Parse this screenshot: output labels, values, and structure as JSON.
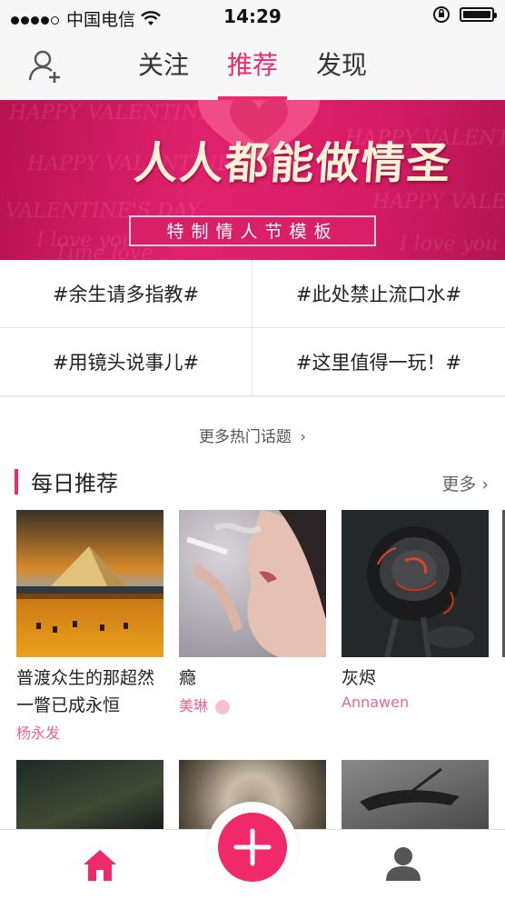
{
  "status_bar": {
    "carrier": "中国电信",
    "time": "14:29"
  },
  "header": {
    "tabs": [
      {
        "label": "关注"
      },
      {
        "label": "推荐"
      },
      {
        "label": "发现"
      }
    ]
  },
  "banner": {
    "title": "人人都能做情圣",
    "subtitle": "特制情人节模板",
    "bg_text": [
      "HAPPY VALENTINE'S DAY",
      "I love you",
      "HAPPY VALENTINE",
      "VALENTINE'S DAY",
      "Time love"
    ]
  },
  "topics": [
    "#余生请多指教#",
    "#此处禁止流口水#",
    "#用镜头说事儿#",
    "#这里值得一玩！#"
  ],
  "more_topics": "更多热门话题",
  "daily": {
    "title": "每日推荐",
    "more": "更多",
    "cards": [
      {
        "title": "普渡众生的那超然一瞥已成永恒",
        "author": "杨永发"
      },
      {
        "title": "瘾",
        "author": "美琳"
      },
      {
        "title": "灰烬",
        "author": "Annawen"
      }
    ]
  },
  "colors": {
    "accent": "#f0296b",
    "banner": "#d81c66"
  }
}
